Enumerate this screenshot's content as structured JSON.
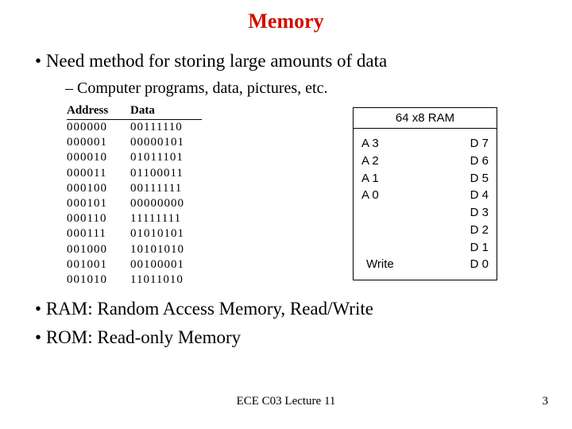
{
  "title": "Memory",
  "bullet1": "Need method for storing large amounts of data",
  "sub1": "Computer programs, data, pictures, etc.",
  "table": {
    "headers": {
      "address": "Address",
      "data": "Data"
    },
    "rows": [
      {
        "addr": "000000",
        "data": "00111110"
      },
      {
        "addr": "000001",
        "data": "00000101"
      },
      {
        "addr": "000010",
        "data": "01011101"
      },
      {
        "addr": "000011",
        "data": "01100011"
      },
      {
        "addr": "000100",
        "data": "00111111"
      },
      {
        "addr": "000101",
        "data": "00000000"
      },
      {
        "addr": "000110",
        "data": "11111111"
      },
      {
        "addr": "000111",
        "data": "01010101"
      },
      {
        "addr": "001000",
        "data": "10101010"
      },
      {
        "addr": "001001",
        "data": "00100001"
      },
      {
        "addr": "001010",
        "data": "11011010"
      }
    ]
  },
  "ram": {
    "title": "64 x8 RAM",
    "left": [
      "A 3",
      "A 2",
      "A 1",
      "A 0"
    ],
    "write": "Write",
    "right": [
      "D 7",
      "D 6",
      "D 5",
      "D 4",
      "D 3",
      "D 2",
      "D 1",
      "D 0"
    ]
  },
  "bullet2": "RAM:  Random Access Memory, Read/Write",
  "bullet3": "ROM:  Read-only Memory",
  "footer_course": "ECE C03 Lecture 11",
  "footer_page": "3"
}
